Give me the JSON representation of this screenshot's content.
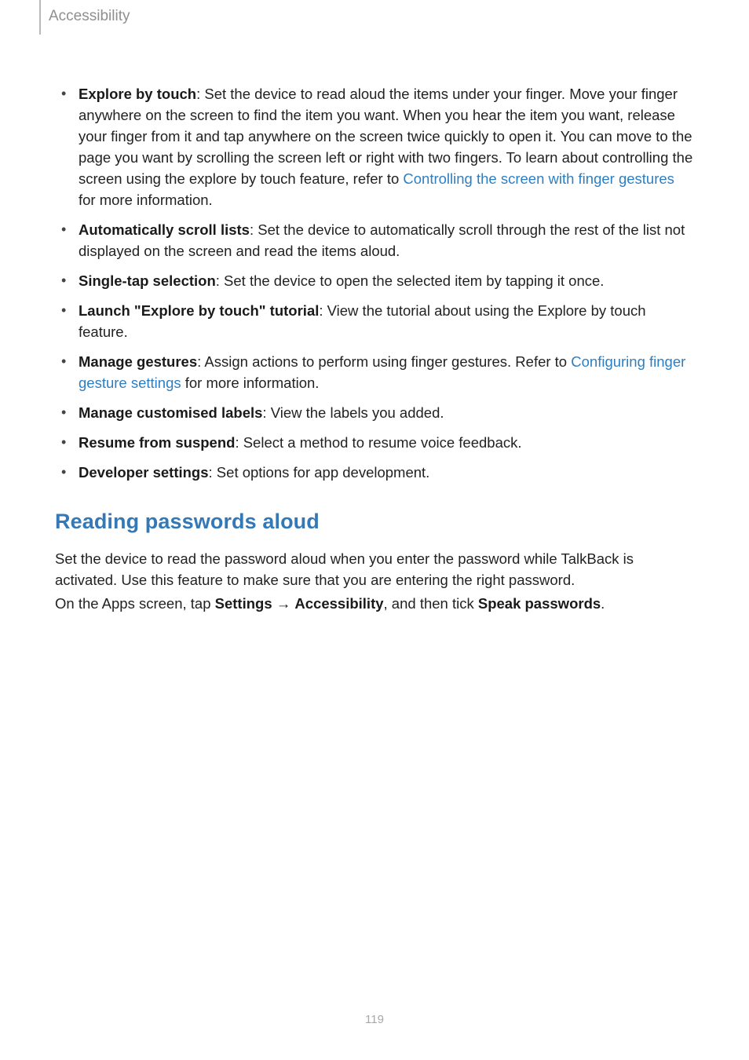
{
  "header": {
    "section": "Accessibility"
  },
  "bullets": {
    "b0": {
      "title": "Explore by touch",
      "text_a": ": Set the device to read aloud the items under your finger. Move your finger anywhere on the screen to find the item you want. When you hear the item you want, release your finger from it and tap anywhere on the screen twice quickly to open it. You can move to the page you want by scrolling the screen left or right with two fingers. To learn about controlling the screen using the explore by touch feature, refer to ",
      "link": "Controlling the screen with finger gestures",
      "text_b": " for more information."
    },
    "b1": {
      "title": "Automatically scroll lists",
      "text": ": Set the device to automatically scroll through the rest of the list not displayed on the screen and read the items aloud."
    },
    "b2": {
      "title": "Single-tap selection",
      "text": ": Set the device to open the selected item by tapping it once."
    },
    "b3": {
      "title": "Launch \"Explore by touch\" tutorial",
      "text": ": View the tutorial about using the Explore by touch feature."
    },
    "b4": {
      "title": "Manage gestures",
      "text_a": ": Assign actions to perform using finger gestures. Refer to ",
      "link": "Configuring finger gesture settings",
      "text_b": " for more information."
    },
    "b5": {
      "title": "Manage customised labels",
      "text": ": View the labels you added."
    },
    "b6": {
      "title": "Resume from suspend",
      "text": ": Select a method to resume voice feedback."
    },
    "b7": {
      "title": "Developer settings",
      "text": ": Set options for app development."
    }
  },
  "heading": "Reading passwords aloud",
  "para1": "Set the device to read the password aloud when you enter the password while TalkBack is activated. Use this feature to make sure that you are entering the right password.",
  "para2": {
    "a": "On the Apps screen, tap ",
    "bold1": "Settings",
    "arrow": " → ",
    "bold2": "Accessibility",
    "b": ", and then tick ",
    "bold3": "Speak passwords",
    "c": "."
  },
  "page_number": "119"
}
